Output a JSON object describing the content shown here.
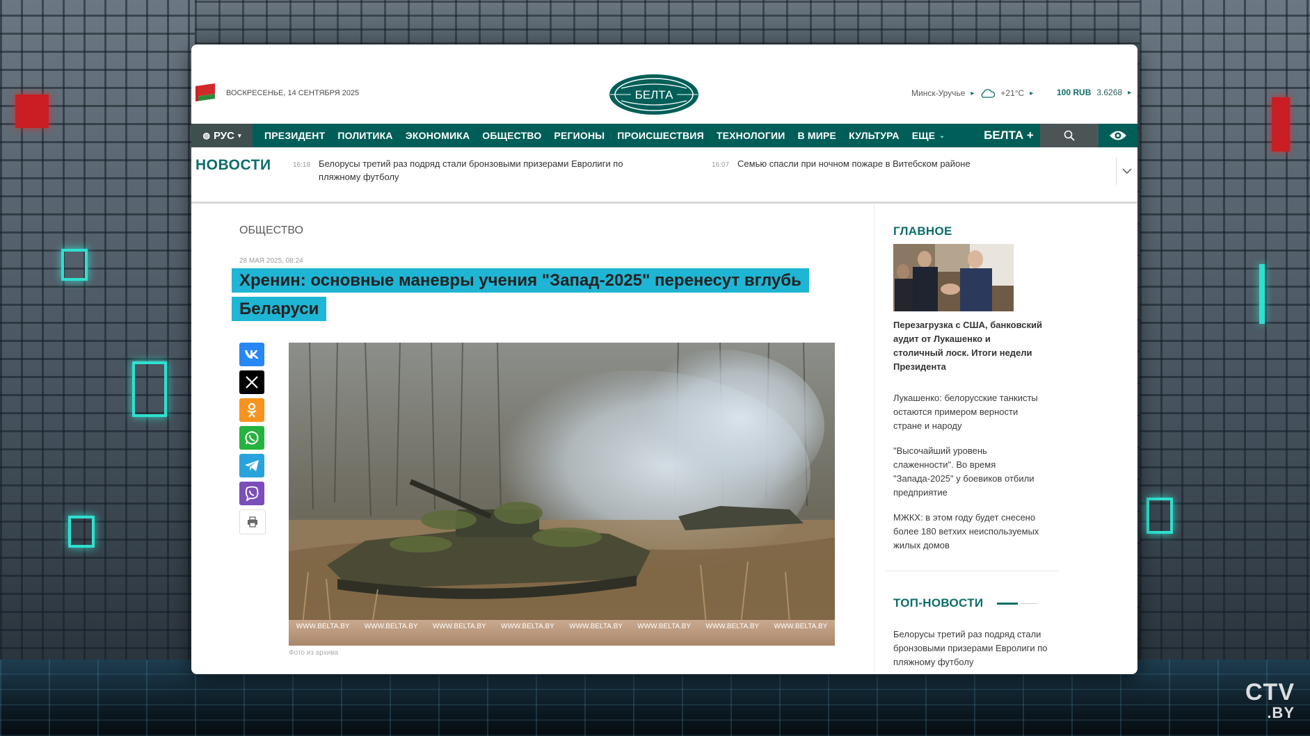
{
  "header": {
    "date": "ВОСКРЕСЕНЬЕ, 14 СЕНТЯБРЯ 2025",
    "logo_text": "БЕЛТА",
    "weather_location": "Минск-Уручье",
    "temperature": "+21°C",
    "rate_label": "100 RUB",
    "rate_value": "3.6268"
  },
  "nav": {
    "lang": "РУС",
    "items": [
      "ПРЕЗИДЕНТ",
      "ПОЛИТИКА",
      "ЭКОНОМИКА",
      "ОБЩЕСТВО",
      "РЕГИОНЫ",
      "ПРОИСШЕСТВИЯ",
      "ТЕХНОЛОГИИ",
      "В МИРЕ",
      "КУЛЬТУРА"
    ],
    "more": "ЕЩЕ",
    "plus": "БЕЛТА +"
  },
  "ticker": {
    "label": "НОВОСТИ",
    "items": [
      {
        "time": "16:18",
        "text": "Белорусы третий раз подряд стали бронзовыми призерами Евролиги по пляжному футболу"
      },
      {
        "time": "16:07",
        "text": "Семью спасли при ночном пожаре в Витебском районе"
      }
    ]
  },
  "article": {
    "rubric": "ОБЩЕСТВО",
    "date": "28 МАЯ 2025, 08:24",
    "title": "Хренин: основные маневры учения \"Запад-2025\" перенесут вглубь Беларуси",
    "watermark": "WWW.BELTA.BY",
    "caption": "Фото из архива"
  },
  "share": {
    "icons": [
      "vk-icon",
      "x-icon",
      "odnoklassniki-icon",
      "whatsapp-icon",
      "telegram-icon",
      "viber-icon",
      "print-icon"
    ]
  },
  "sidebar": {
    "main_heading": "ГЛАВНОЕ",
    "lead": "Перезагрузка с США, банковский аудит от Лукашенко и столичный лоск. Итоги недели Президента",
    "items": [
      "Лукашенко: белорусские танкисты остаются примером верности стране и народу",
      "\"Высочайший уровень слаженности\". Во время \"Запада-2025\" у боевиков отбили предприятие",
      "МЖКХ: в этом году будет снесено более 180 ветхих неиспользуемых жилых домов"
    ],
    "top_heading": "ТОП-НОВОСТИ",
    "top_item": "Белорусы третий раз подряд стали бронзовыми призерами Евролиги по пляжному футболу"
  },
  "overlay": {
    "channel_logo": "CTV",
    "channel_suffix": ".BY"
  },
  "colors": {
    "brand": "#005e58",
    "accent_text": "#0b6d6b",
    "headline_highlight": "#1fb5d4"
  }
}
